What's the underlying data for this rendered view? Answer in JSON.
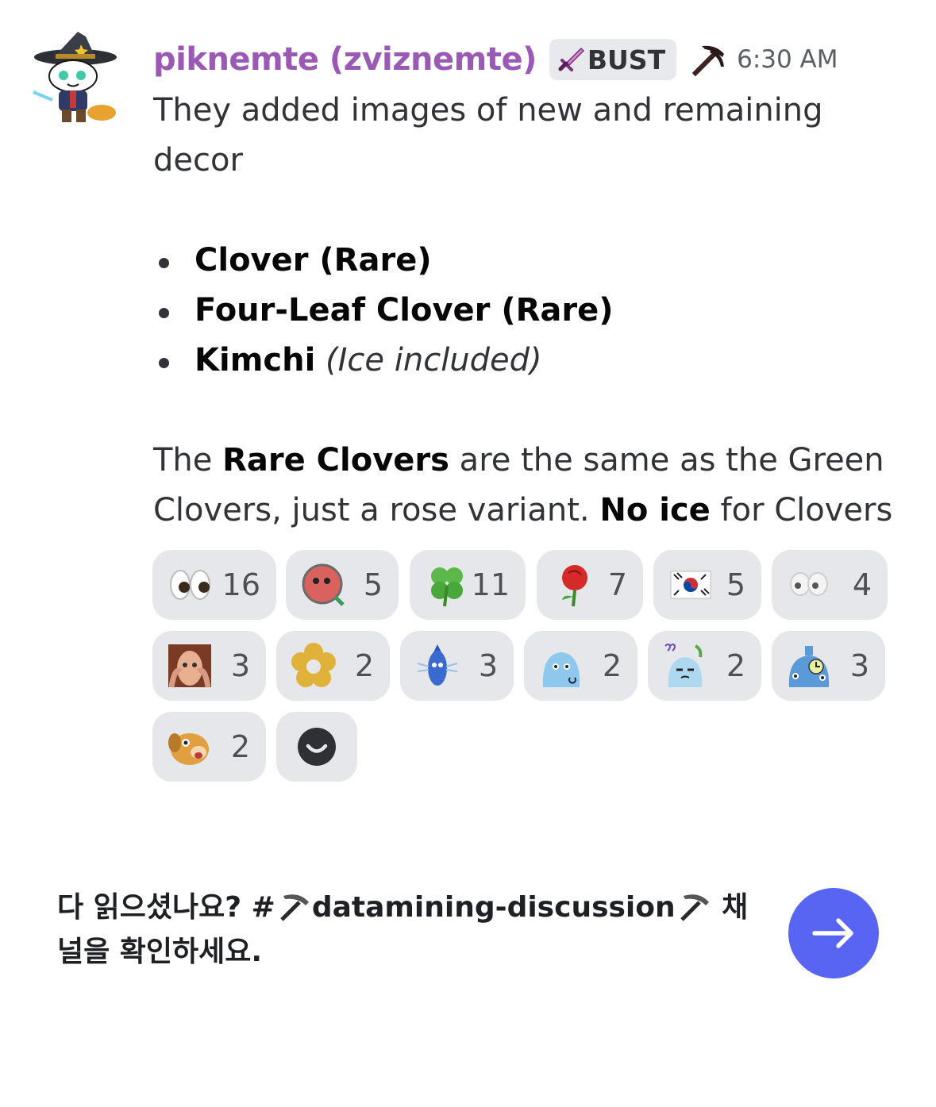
{
  "message": {
    "author": "piknemte (zviznemte)",
    "tag": "BUST",
    "tag_icon": "sword-icon",
    "badge_icon": "pickaxe-icon",
    "timestamp": "6:30 AM",
    "intro": "They added images of new and remaining decor",
    "items": [
      {
        "bold": "Clover (Rare)",
        "italic": ""
      },
      {
        "bold": "Four-Leaf Clover (Rare)",
        "italic": ""
      },
      {
        "bold": "Kimchi",
        "italic": "(Ice included)"
      }
    ],
    "closing": {
      "t1": "The ",
      "b1": "Rare Clovers",
      "t2": " are the same as the Green Clovers, just a rose variant. ",
      "b2": "No ice",
      "t3": " for Clovers"
    },
    "username_color": "#9b59b6"
  },
  "reactions": [
    {
      "emoji": "eyes-emoji",
      "count": "16"
    },
    {
      "emoji": "red-creature-magnifier-emoji",
      "count": "5"
    },
    {
      "emoji": "four-leaf-clover-emoji",
      "count": "11"
    },
    {
      "emoji": "rose-emoji",
      "count": "7"
    },
    {
      "emoji": "south-korea-flag-emoji",
      "count": "5"
    },
    {
      "emoji": "white-eyes-emoji",
      "count": "4"
    },
    {
      "emoji": "stressed-man-emoji",
      "count": "3"
    },
    {
      "emoji": "gold-flower-emoji",
      "count": "2"
    },
    {
      "emoji": "blue-pikmin-emoji",
      "count": "3"
    },
    {
      "emoji": "ice-blob-emoji",
      "count": "2"
    },
    {
      "emoji": "confused-ice-blob-emoji",
      "count": "2"
    },
    {
      "emoji": "blue-creature-clock-emoji",
      "count": "3"
    },
    {
      "emoji": "oatchi-dog-emoji",
      "count": "2"
    }
  ],
  "add_reaction_icon": "add-reaction-icon",
  "banner": {
    "text_before": "다 읽으셨나요? #",
    "channel": "datamining-discussion",
    "text_after": " 채널을 확인하세요."
  },
  "send_button_icon": "arrow-right-icon",
  "colors": {
    "accent": "#5865f2",
    "pill": "#e6e7ea"
  }
}
